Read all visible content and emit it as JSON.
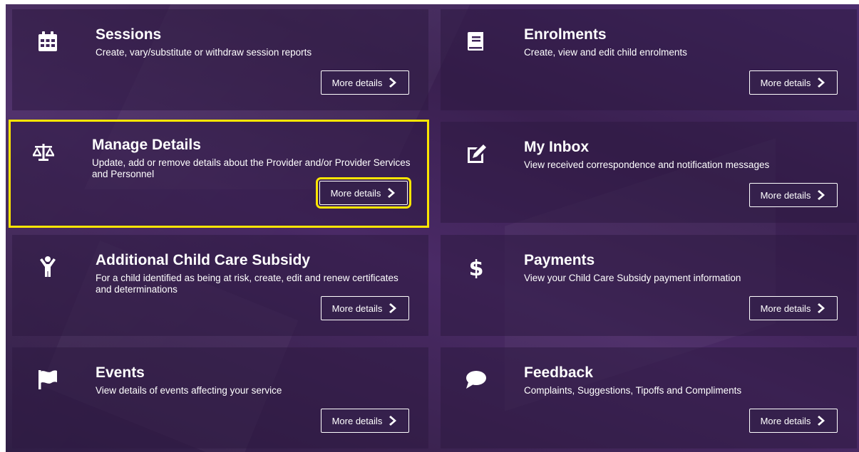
{
  "colors": {
    "highlight": "#ffe600",
    "panel": "#3e2459",
    "text": "#ffffff"
  },
  "tiles": [
    {
      "icon": "calendar-icon",
      "title": "Sessions",
      "description": "Create, vary/substitute or withdraw session reports",
      "button": "More details"
    },
    {
      "icon": "book-icon",
      "title": "Enrolments",
      "description": "Create, view and edit child enrolments",
      "button": "More details"
    },
    {
      "icon": "balance-scale-icon",
      "title": "Manage Details",
      "description": "Update, add or remove details about the Provider and/or Provider Services and Personnel",
      "button": "More details"
    },
    {
      "icon": "edit-icon",
      "title": "My Inbox",
      "description": "View received correspondence and notification messages",
      "button": "More details"
    },
    {
      "icon": "child-icon",
      "title": "Additional Child Care Subsidy",
      "description": "For a child identified as being at risk, create, edit and renew certificates and determinations",
      "button": "More details"
    },
    {
      "icon": "dollar-icon",
      "title": "Payments",
      "description": "View your Child Care Subsidy payment information",
      "button": "More details"
    },
    {
      "icon": "flag-icon",
      "title": "Events",
      "description": "View details of events affecting your service",
      "button": "More details"
    },
    {
      "icon": "comment-icon",
      "title": "Feedback",
      "description": "Complaints, Suggestions, Tipoffs and Compliments",
      "button": "More details"
    }
  ]
}
